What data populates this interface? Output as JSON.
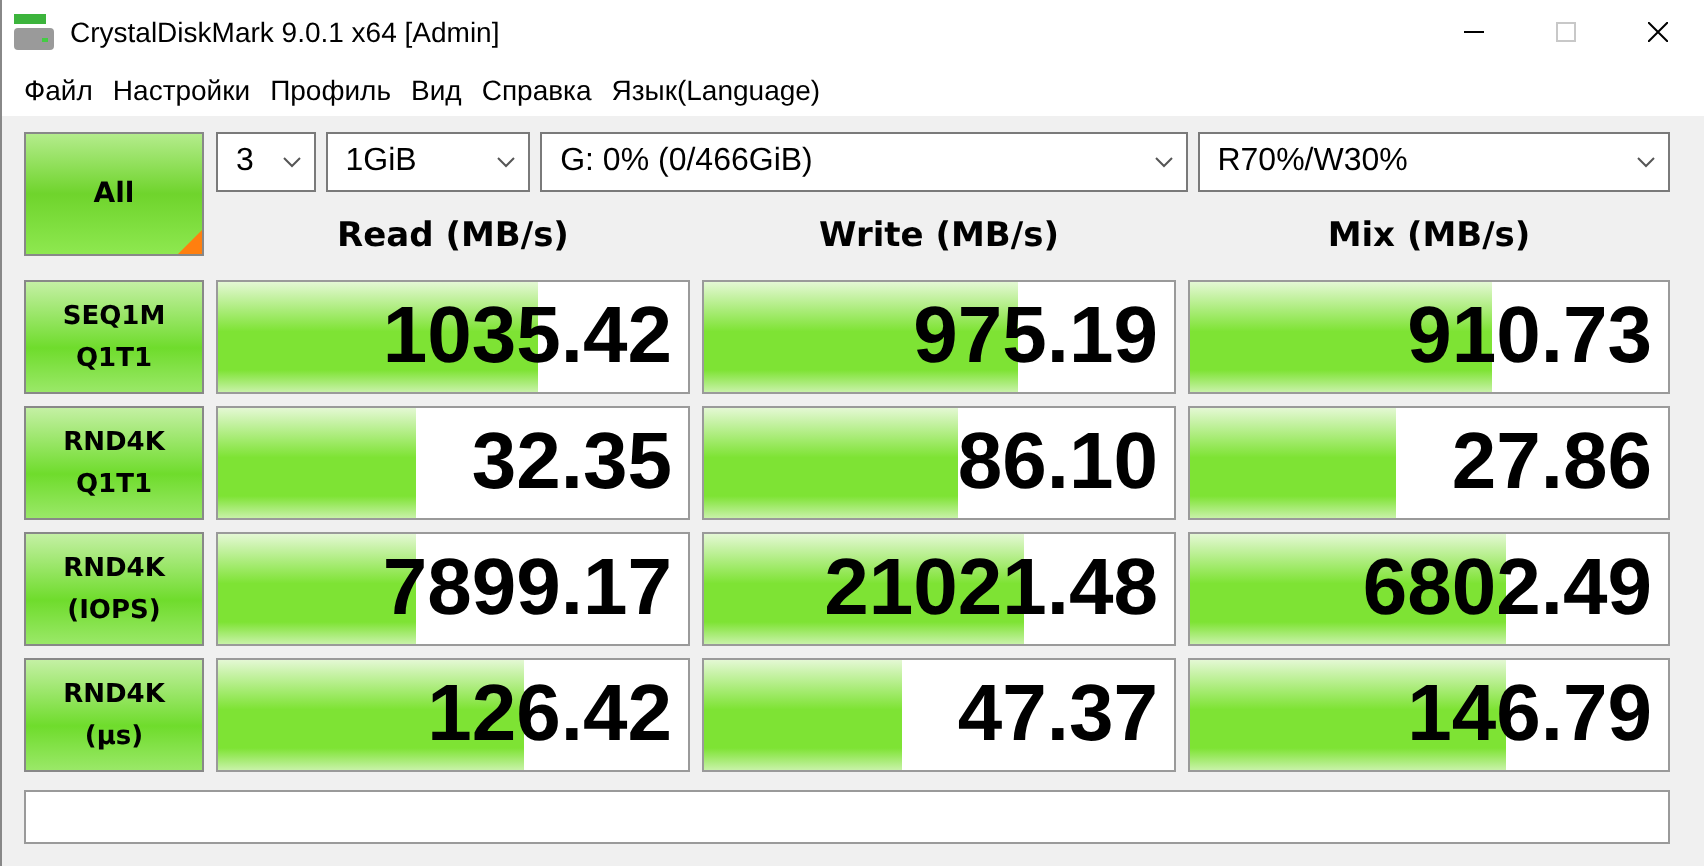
{
  "window": {
    "title": "CrystalDiskMark 9.0.1 x64 [Admin]",
    "maximize_disabled": true
  },
  "menu": [
    "Файл",
    "Настройки",
    "Профиль",
    "Вид",
    "Справка",
    "Язык(Language)"
  ],
  "controls": {
    "all_button": "All",
    "count": "3",
    "size": "1GiB",
    "drive": "G: 0% (0/466GiB)",
    "mix": "R70%/W30%"
  },
  "columns": [
    "Read (MB/s)",
    "Write (MB/s)",
    "Mix (MB/s)"
  ],
  "rows": [
    {
      "label": [
        "SEQ1M",
        "Q1T1"
      ],
      "cells": [
        {
          "value": "1035.42",
          "level": 0.68
        },
        {
          "value": "975.19",
          "level": 0.67
        },
        {
          "value": "910.73",
          "level": 0.63
        }
      ]
    },
    {
      "label": [
        "RND4K",
        "Q1T1"
      ],
      "cells": [
        {
          "value": "32.35",
          "level": 0.42
        },
        {
          "value": "86.10",
          "level": 0.54
        },
        {
          "value": "27.86",
          "level": 0.43
        }
      ]
    },
    {
      "label": [
        "RND4K",
        "(IOPS)"
      ],
      "cells": [
        {
          "value": "7899.17",
          "level": 0.42
        },
        {
          "value": "21021.48",
          "level": 0.68
        },
        {
          "value": "6802.49",
          "level": 0.66
        }
      ]
    },
    {
      "label": [
        "RND4K",
        "(µs)"
      ],
      "cells": [
        {
          "value": "126.42",
          "level": 0.65
        },
        {
          "value": "47.37",
          "level": 0.42
        },
        {
          "value": "146.79",
          "level": 0.66
        }
      ]
    }
  ]
}
